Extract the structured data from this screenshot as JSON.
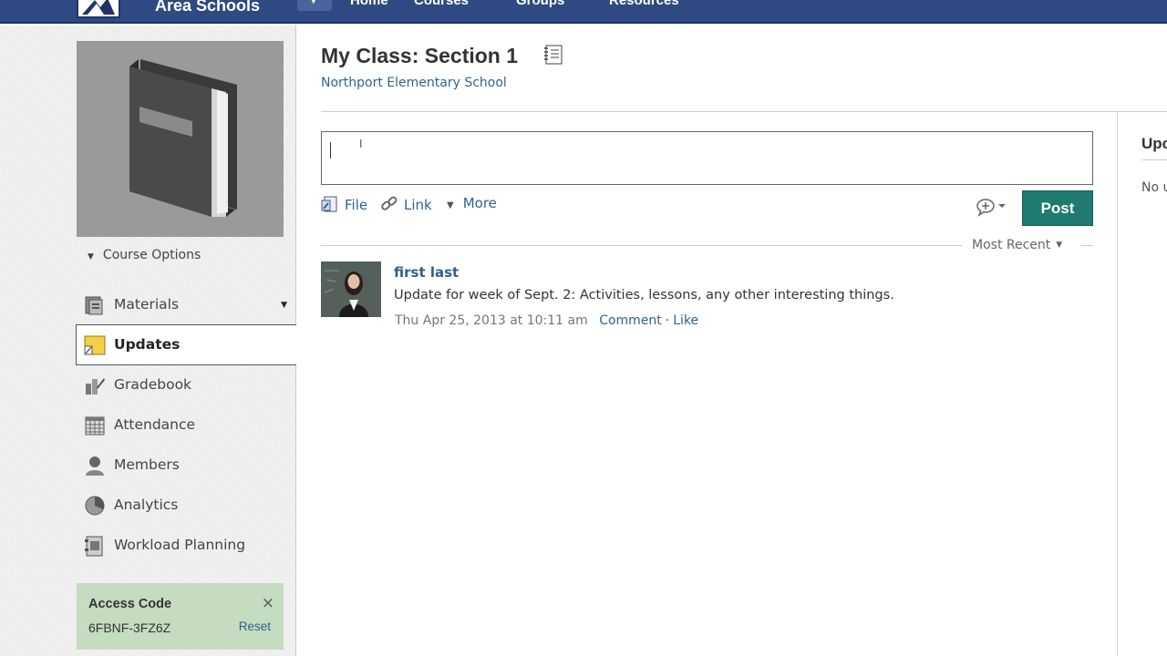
{
  "topbar": {
    "school_name": "Area Schools",
    "nav": [
      "Home",
      "Courses",
      "Groups",
      "Resources"
    ]
  },
  "sidebar": {
    "course_options_label": "Course Options",
    "items": [
      {
        "label": "Materials",
        "icon": "materials-icon"
      },
      {
        "label": "Updates",
        "icon": "updates-icon",
        "active": true
      },
      {
        "label": "Gradebook",
        "icon": "gradebook-icon"
      },
      {
        "label": "Attendance",
        "icon": "attendance-icon"
      },
      {
        "label": "Members",
        "icon": "members-icon"
      },
      {
        "label": "Analytics",
        "icon": "analytics-icon"
      },
      {
        "label": "Workload Planning",
        "icon": "workload-icon"
      }
    ],
    "access_code": {
      "title": "Access Code",
      "code": "6FBNF-3FZ6Z",
      "reset_label": "Reset",
      "close_glyph": "×"
    }
  },
  "main": {
    "title": "My Class: Section 1",
    "school": "Northport Elementary School",
    "post_input": {
      "value": ""
    },
    "attachments": {
      "file_label": "File",
      "link_label": "Link",
      "more_label": "More"
    },
    "post_button": "Post",
    "sort": "Most Recent",
    "feed": [
      {
        "author": "first last",
        "body": "Update for week of Sept. 2: Activities, lessons, any other interesting things.",
        "timestamp": "Thu Apr 25, 2013 at 10:11 am",
        "comment_label": "Comment",
        "like_label": "Like"
      }
    ]
  },
  "right_panel": {
    "title": "Upc",
    "body": "No u"
  },
  "colors": {
    "topbar": "#2f4a83",
    "post_button": "#1f7a70",
    "link": "#2f6491",
    "access_box": "#c5dcc0"
  }
}
